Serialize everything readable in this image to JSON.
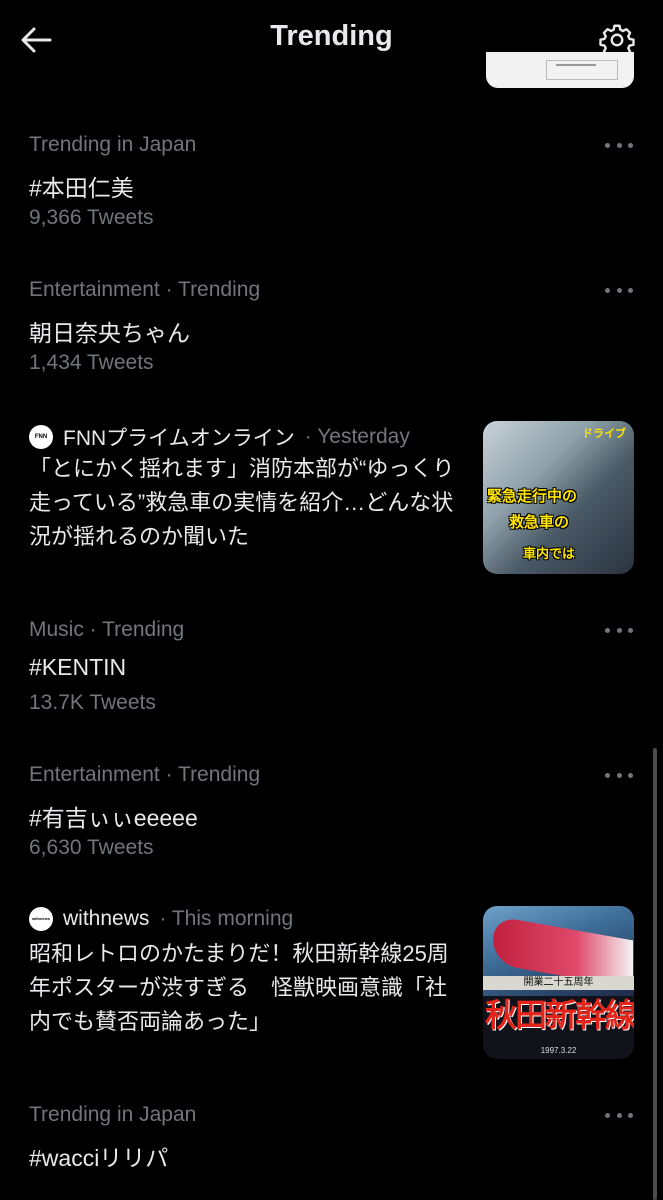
{
  "header": {
    "title": "Trending"
  },
  "trends": [
    {
      "meta": "Trending in Japan",
      "topic": "#本田仁美",
      "count": "9,366 Tweets"
    },
    {
      "meta": "Entertainment · Trending",
      "topic": "朝日奈央ちゃん",
      "count": "1,434 Tweets"
    },
    {
      "meta": "Music · Trending",
      "topic": "#KENTIN",
      "count": "13.7K Tweets"
    },
    {
      "meta": "Entertainment · Trending",
      "topic": "#有吉ぃぃeeeee",
      "count": "6,630 Tweets"
    },
    {
      "meta": "Trending in Japan",
      "topic": "#wacciリリパ",
      "count": ""
    }
  ],
  "news": [
    {
      "source": "FNNプライムオンライン",
      "time": "· Yesterday",
      "logo_text": "FNN",
      "headline": "「とにかく揺れます」消防本部が“ゆっくり走っている”救急車の実情を紹介…どんな状況が揺れるのか聞いた",
      "thumb_caption_1": "緊急走行中の",
      "thumb_caption_2": "救急車の",
      "thumb_caption_3": "車内では",
      "thumb_tag": "ドライブ"
    },
    {
      "source": "withnews",
      "time": "· This morning",
      "logo_text": "withnews",
      "headline": "昭和レトロのかたまりだ！秋田新幹線25周年ポスターが渋すぎる　怪獣映画意識「社内でも賛否両論あった」",
      "thumb_banner": "開業二十五周年",
      "thumb_title": "秋田新幹線",
      "thumb_date": "1997.3.22"
    }
  ],
  "icons": {
    "back": "arrow-left-icon",
    "settings": "gear-icon",
    "more": "more-horizontal-icon"
  },
  "colors": {
    "background": "#000000",
    "primary_text": "#e7e9ea",
    "secondary_text": "#71767b"
  }
}
